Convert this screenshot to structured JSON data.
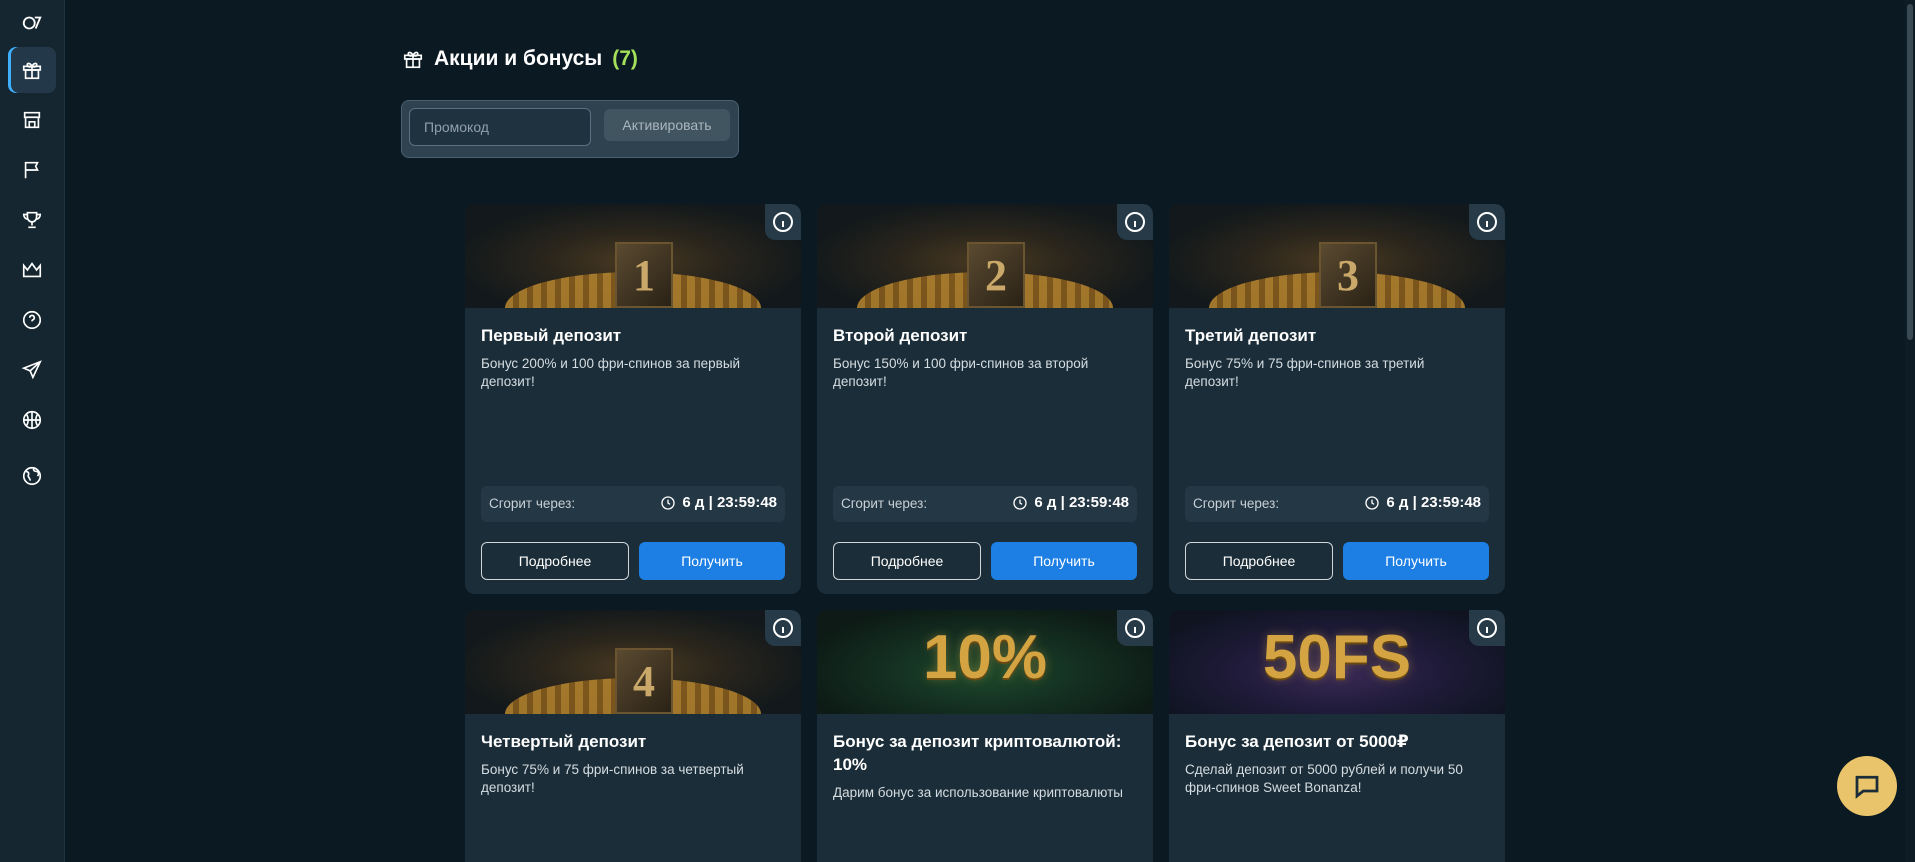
{
  "sidebar": {
    "icons": [
      "logo-icon",
      "gift-icon",
      "store-icon",
      "flag-icon",
      "trophy-icon",
      "crown-icon",
      "help-icon",
      "send-icon",
      "basketball-icon",
      "globe-icon"
    ]
  },
  "header": {
    "title": "Акции и бонусы",
    "count": "(7)"
  },
  "promo": {
    "placeholder": "Промокод",
    "activate_label": "Активировать"
  },
  "cards": [
    {
      "title": "Первый депозит",
      "description": "Бонус 200% и 100 фри-спинов за первый депозит!",
      "expire_label": "Сгорит через:",
      "expire_time": "6 д | 23:59:48",
      "more_label": "Подробнее",
      "get_label": "Получить",
      "banner_text": "1"
    },
    {
      "title": "Второй депозит",
      "description": "Бонус 150% и 100 фри-спинов за второй депозит!",
      "expire_label": "Сгорит через:",
      "expire_time": "6 д | 23:59:48",
      "more_label": "Подробнее",
      "get_label": "Получить",
      "banner_text": "2"
    },
    {
      "title": "Третий депозит",
      "description": "Бонус 75% и 75 фри-спинов за третий депозит!",
      "expire_label": "Сгорит через:",
      "expire_time": "6 д | 23:59:48",
      "more_label": "Подробнее",
      "get_label": "Получить",
      "banner_text": "3"
    },
    {
      "title": "Четвертый депозит",
      "description": "Бонус 75% и 75 фри-спинов за четвертый депозит!",
      "banner_text": "4"
    },
    {
      "title": "Бонус за депозит криптовалютой: 10%",
      "description": "Дарим бонус за использование криптовалюты",
      "banner_text": "10%"
    },
    {
      "title": "Бонус за депозит от 5000₽",
      "description": "Сделай депозит от 5000 рублей и получи 50 фри-спинов Sweet Bonanza!",
      "banner_text": "50FS"
    }
  ],
  "colors": {
    "accent": "#1d7fe3",
    "count": "#a4e05a",
    "chat": "#e9c46a"
  }
}
